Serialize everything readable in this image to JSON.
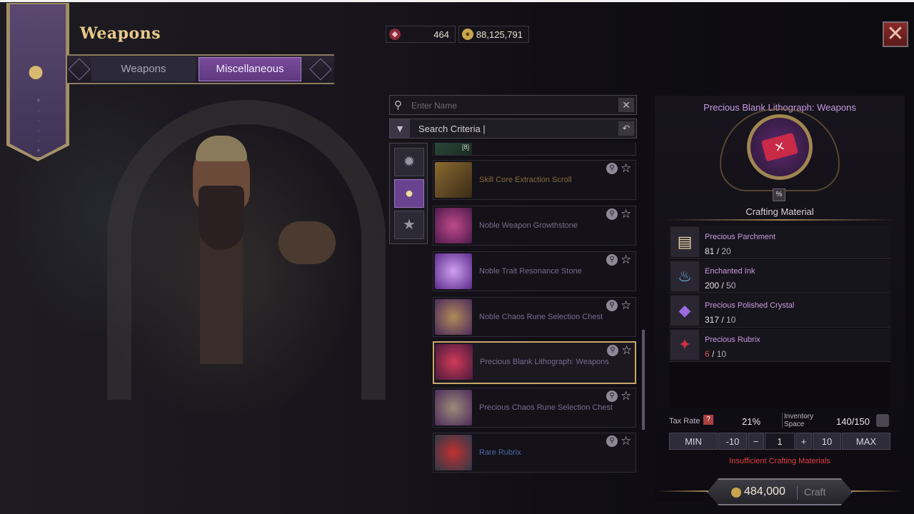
{
  "header": {
    "title": "Weapons"
  },
  "tabs": [
    {
      "label": "Weapons",
      "active": false
    },
    {
      "label": "Miscellaneous",
      "active": true
    }
  ],
  "currency": [
    {
      "icon": "crystal-icon",
      "value": "464"
    },
    {
      "icon": "gold-coin-icon",
      "value": "88,125,791"
    }
  ],
  "search": {
    "placeholder": "Enter Name",
    "criteria_label": "Search Criteria  |"
  },
  "categories": [
    "sun-emblem-icon",
    "money-bag-icon",
    "star-icon"
  ],
  "items": [
    {
      "name": "",
      "badge": "[8]",
      "selected": false
    },
    {
      "name": "Skill Core Extraction Scroll",
      "color": "#8a6a3a",
      "selected": false
    },
    {
      "name": "Noble Weapon Growthstone",
      "color": "#7a5a8e",
      "selected": false
    },
    {
      "name": "Noble Trait Resonance Stone",
      "color": "#7a5a8e",
      "selected": false
    },
    {
      "name": "Noble Chaos Rune Selection Chest",
      "color": "#7a5a8e",
      "selected": false
    },
    {
      "name": "Precious Blank Lithograph: Weapons",
      "color": "#7a5a8e",
      "selected": true
    },
    {
      "name": "Precious Chaos Rune Selection Chest",
      "color": "#7a5a8e",
      "selected": false
    },
    {
      "name": "Rare Rubrix",
      "color": "#4a6aa8",
      "selected": false
    }
  ],
  "craft": {
    "title": "Precious Blank Lithograph: Weapons",
    "subtitle": "Crafting Material",
    "materials": [
      {
        "name": "Precious Parchment",
        "have": "81",
        "need": "20",
        "low": false,
        "icon": "parchment-icon"
      },
      {
        "name": "Enchanted Ink",
        "have": "200",
        "need": "50",
        "low": false,
        "icon": "ink-bottle-icon"
      },
      {
        "name": "Precious Polished Crystal",
        "have": "317",
        "need": "10",
        "low": false,
        "icon": "crystal-icon"
      },
      {
        "name": "Precious Rubrix",
        "have": "6",
        "need": "10",
        "low": true,
        "icon": "rubrix-icon"
      }
    ],
    "tax_label": "Tax Rate",
    "tax_value": "21%",
    "inventory_label": "Inventory Space",
    "inventory_value": "140/150",
    "qty": {
      "min": "MIN",
      "minus10": "-10",
      "minus": "−",
      "value": "1",
      "plus": "+",
      "plus10": "10",
      "max": "MAX"
    },
    "warning": "Insufficient Crafting Materials",
    "cost": "484,000",
    "craft_label": "Craft"
  }
}
